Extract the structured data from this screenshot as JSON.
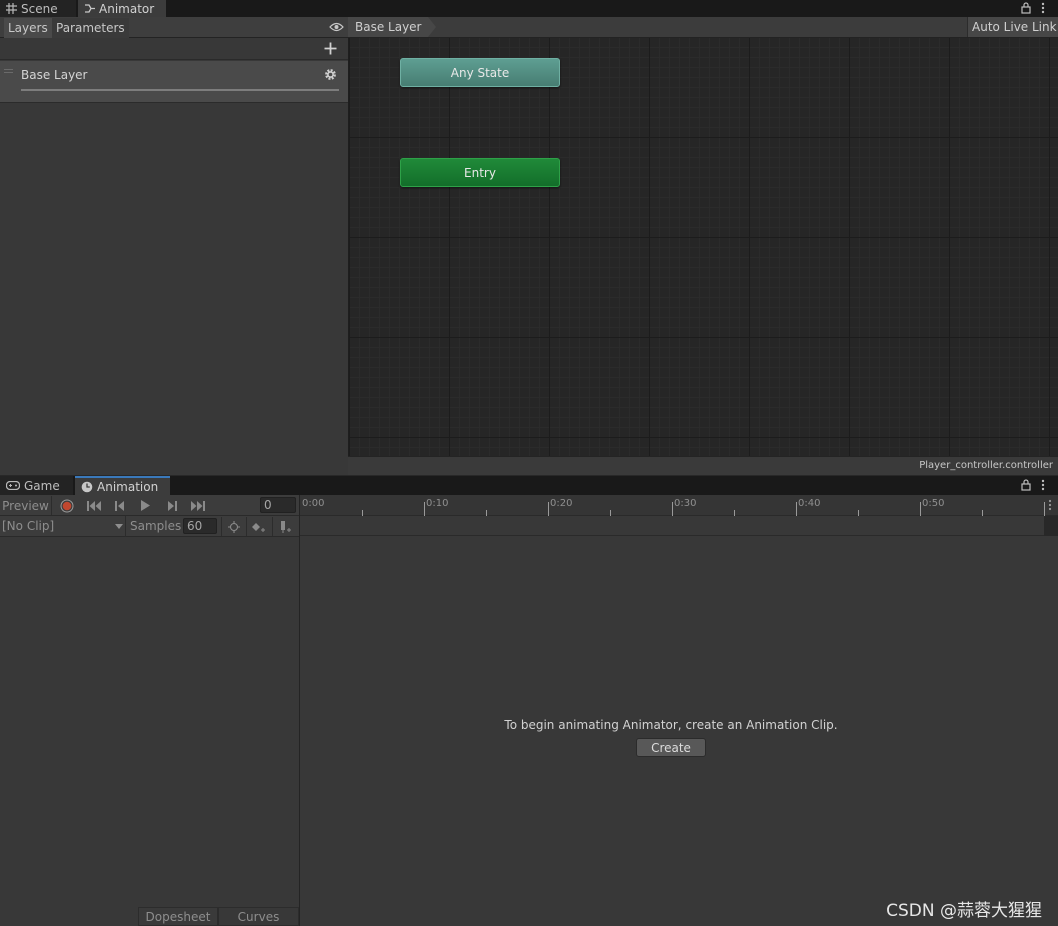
{
  "top_tabs": [
    {
      "label": "Scene",
      "icon": "grid-icon"
    },
    {
      "label": "Animator",
      "icon": "animator-icon"
    }
  ],
  "animator": {
    "subtabs": [
      "Layers",
      "Parameters"
    ],
    "layer_name": "Base Layer",
    "breadcrumb": "Base Layer",
    "auto_live_link": "Auto Live Link",
    "states": {
      "any_state": "Any State",
      "entry": "Entry"
    },
    "footer_file": "Player_controller.controller"
  },
  "bottom_tabs": [
    {
      "label": "Game",
      "icon": "gamepad-icon"
    },
    {
      "label": "Animation",
      "icon": "clock-icon"
    }
  ],
  "animation": {
    "preview_label": "Preview",
    "frame_value": "0",
    "clip_select": "[No Clip]",
    "samples_label": "Samples",
    "samples_value": "60",
    "bottom_tabs": [
      "Dopesheet",
      "Curves"
    ],
    "timeline_ticks": [
      "0:00",
      "0:10",
      "0:20",
      "0:30",
      "0:40",
      "0:50"
    ],
    "empty_message": "To begin animating Animator, create an Animation Clip.",
    "create_label": "Create"
  },
  "watermark": "CSDN @蒜蓉大猩猩",
  "colors": {
    "any_state": "#50897d",
    "entry_state": "#197a31",
    "record_dot": "#c0472f"
  }
}
